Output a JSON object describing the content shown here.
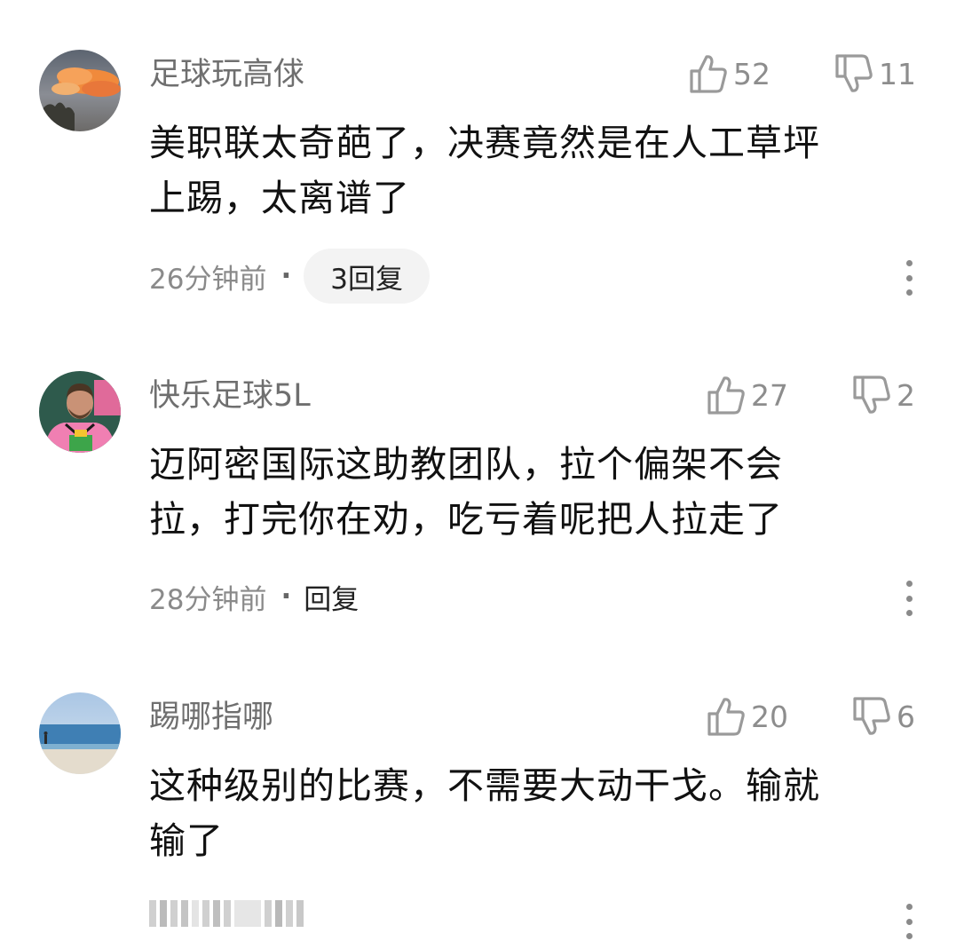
{
  "comments": [
    {
      "username": "足球玩高俅",
      "text_line1": "美职联太奇葩了，决赛竟然是在人工草坪",
      "text_line2": "上踢，太离谱了",
      "time": "26分钟前",
      "separator": "·",
      "reply_label": "3回复",
      "likes": "52",
      "dislikes": "11",
      "avatar_icon": "sunset-clouds-avatar"
    },
    {
      "username": "快乐足球5L",
      "text_line1": "迈阿密国际这助教团队，拉个偏架不会",
      "text_line2": "拉，打完你在劝，吃亏着呢把人拉走了",
      "time": "28分钟前",
      "separator": "·",
      "reply_label": "回复",
      "likes": "27",
      "dislikes": "2",
      "avatar_icon": "soccer-player-pink-jersey-avatar"
    },
    {
      "username": "踢哪指哪",
      "text_line1": "这种级别的比赛，不需要大动干戈。输就",
      "text_line2": "输了",
      "likes": "20",
      "dislikes": "6",
      "avatar_icon": "beach-sea-avatar"
    }
  ],
  "icons": {
    "like": "thumbs-up-icon",
    "dislike": "thumbs-down-icon",
    "more": "more-vertical-icon"
  },
  "colors": {
    "username": "#6f6f6f",
    "meta": "#8a8a8a",
    "pill_bg": "#f3f3f3"
  }
}
